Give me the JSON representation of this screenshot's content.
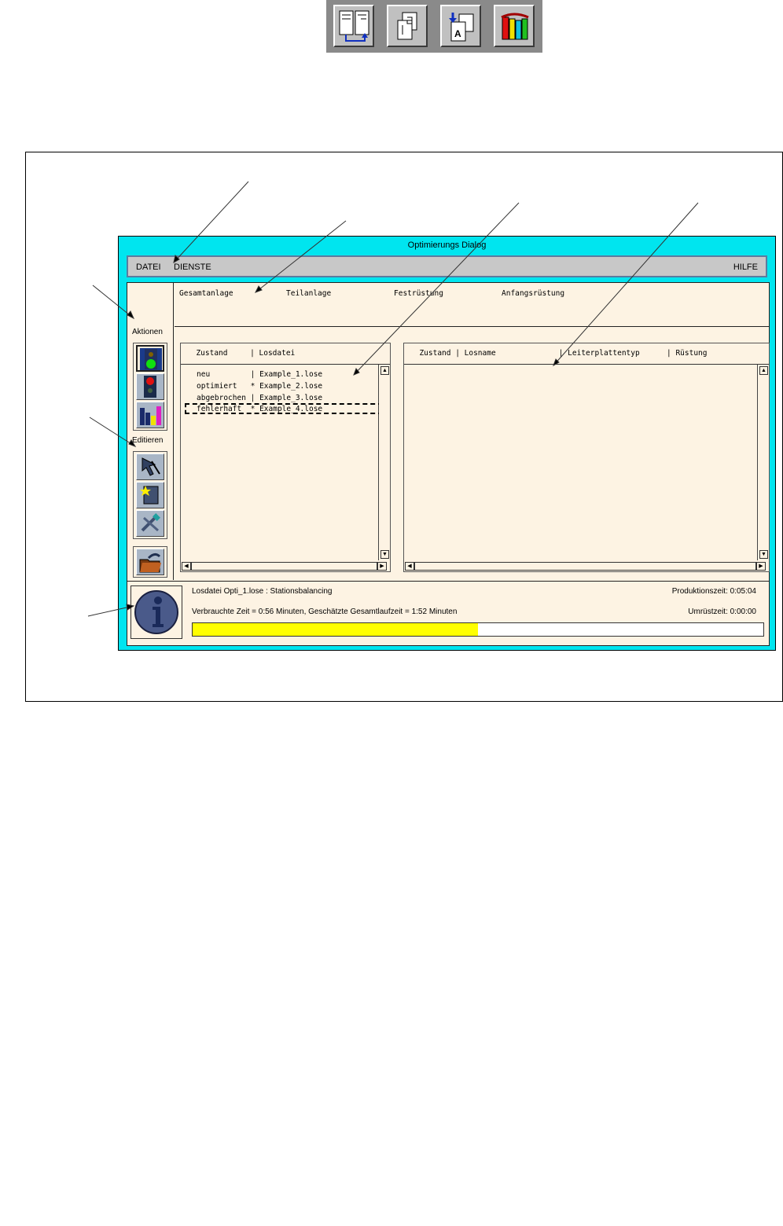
{
  "toolbar": {
    "icons": [
      "layout-compare-icon",
      "pages-icon",
      "replace-document-icon",
      "books-icon"
    ]
  },
  "window": {
    "title": "Optimierungs Dialog"
  },
  "menu": {
    "datei": "DATEI",
    "dienste": "DIENSTE",
    "hilfe": "HILFE"
  },
  "sidebar": {
    "aktionen_label": "Aktionen",
    "editieren_label": "Editieren"
  },
  "tabs": [
    "Gesamtanlage",
    "Teilanlage",
    "Festrüstung",
    "Anfangsrüstung"
  ],
  "left_list": {
    "header": "  Zustand     | Losdatei",
    "rows": [
      "neu         | Example_1.lose",
      "optimiert   * Example_2.lose",
      "abgebrochen | Example_3.lose",
      "fehlerhaft  * Example_4.lose"
    ]
  },
  "right_list": {
    "header": "  Zustand | Losname              | Leiterplattentyp      | Rüstung",
    "rows": []
  },
  "status": {
    "file_line": "Losdatei Opti_1.lose : Stationsbalancing",
    "production_time": "Produktionszeit: 0:05:04",
    "time_line": "Verbrauchte Zeit = 0:56 Minuten, Geschätzte Gesamtlaufzeit = 1:52 Minuten",
    "changeover_time": "Umrüstzeit: 0:00:00",
    "progress_fraction": 0.5,
    "progress_color": "#ffff00"
  },
  "colors": {
    "window_frame": "#00e5ef",
    "panel_background": "#fdf3e3",
    "menubar": "#c8c8c8"
  }
}
